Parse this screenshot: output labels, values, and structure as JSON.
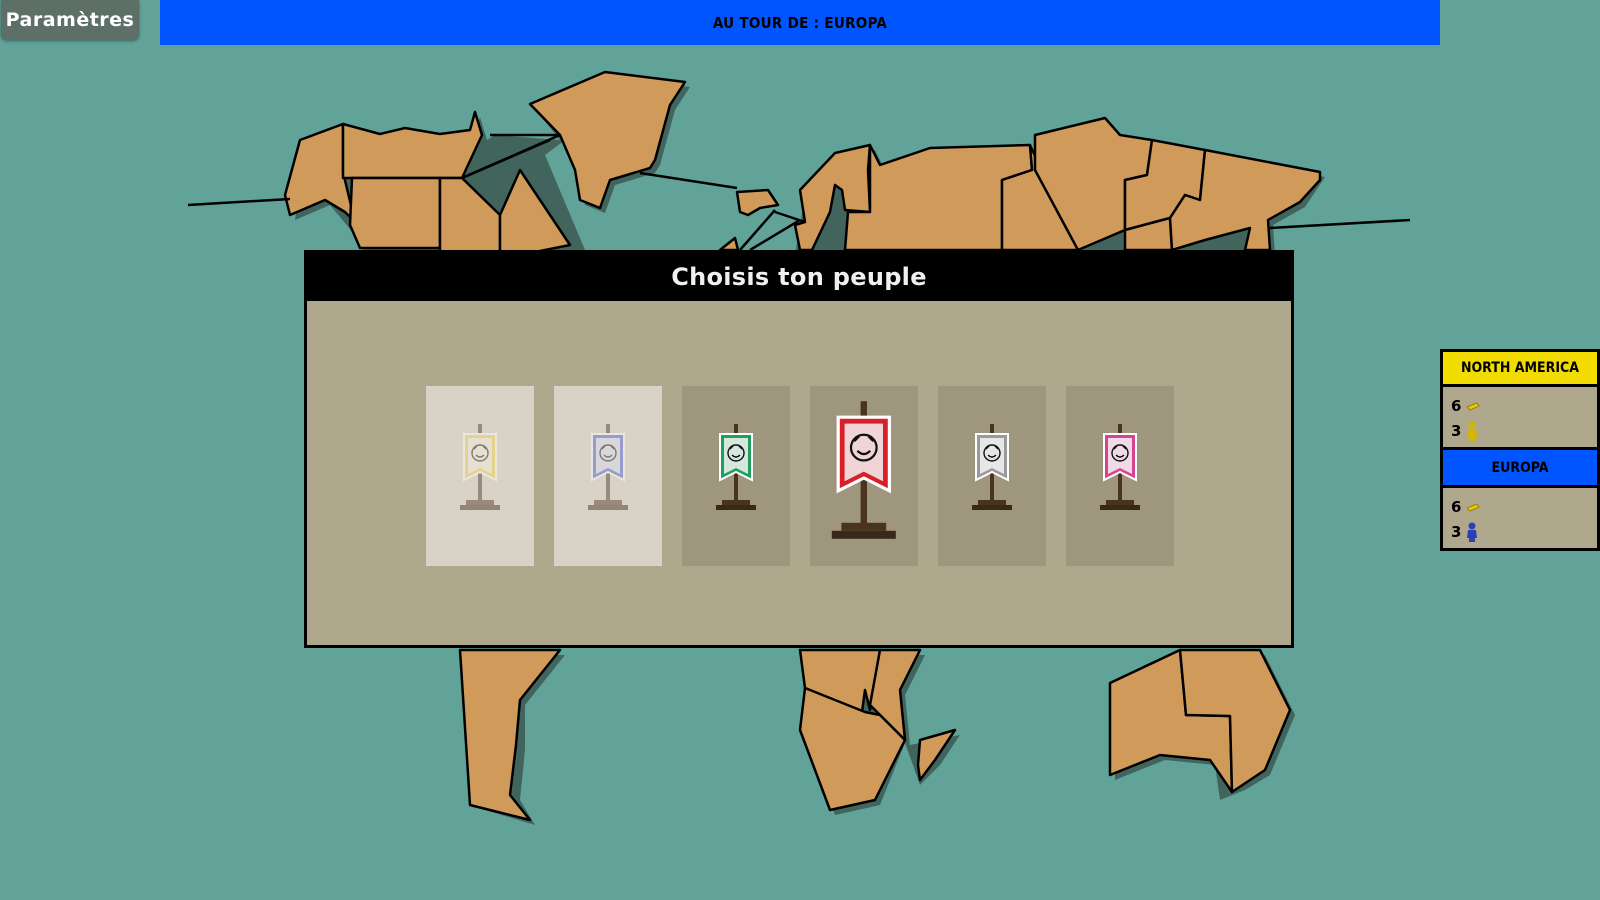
{
  "settings": {
    "label": "Paramètres"
  },
  "turn_banner": {
    "text": "AU TOUR DE : EUROPA",
    "color": "#0055ff"
  },
  "modal": {
    "title": "Choisis ton peuple",
    "peoples": [
      {
        "animal-icon": "tiger-icon",
        "color": "#f3d44a",
        "state": "disabled"
      },
      {
        "animal-icon": "wolf-icon",
        "color": "#4a5ad8",
        "state": "disabled"
      },
      {
        "animal-icon": "bear-icon",
        "color": "#1f9e60",
        "state": "available"
      },
      {
        "animal-icon": "eagle-icon",
        "color": "#d8202a",
        "state": "selected"
      },
      {
        "animal-icon": "lion-icon",
        "color": "#9a9a9a",
        "state": "available"
      },
      {
        "animal-icon": "unicorn-icon",
        "color": "#d8438f",
        "state": "available"
      }
    ]
  },
  "teams": [
    {
      "name": "NORTH AMERICA",
      "color": "#f2dc00",
      "pieces": "6",
      "troops": "3",
      "troop-icon-color": "#d4b800"
    },
    {
      "name": "EUROPA",
      "color": "#0055ff",
      "pieces": "6",
      "troops": "3",
      "troop-icon-color": "#2b3fb0"
    }
  ],
  "colors": {
    "ocean": "#61a399",
    "land": "#d09a5a",
    "panel": "#b0a88c"
  }
}
